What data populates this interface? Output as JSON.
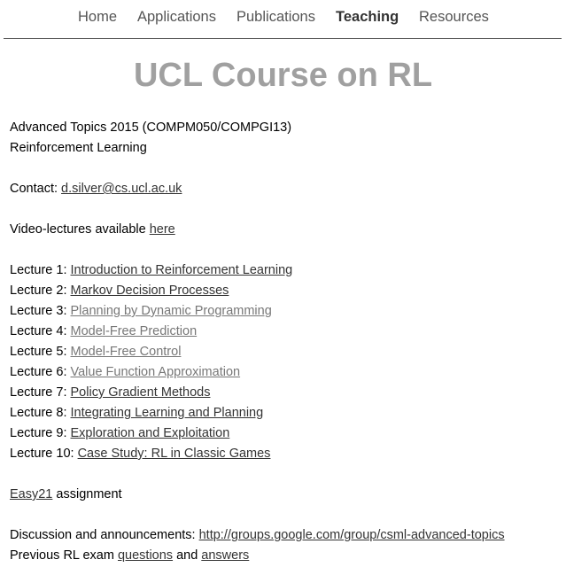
{
  "nav": {
    "items": [
      "Home",
      "Applications",
      "Publications",
      "Teaching",
      "Resources"
    ],
    "active": "Teaching"
  },
  "title": "UCL Course on RL",
  "course": {
    "line1": "Advanced Topics  2015 (COMPM050/COMPGI13)",
    "line2": "Reinforcement Learning"
  },
  "contact": {
    "label": "Contact: ",
    "email": "d.silver@cs.ucl.ac.uk"
  },
  "video": {
    "text": "Video-lectures available ",
    "link": "here"
  },
  "lectures": [
    {
      "label": "Lecture 1: ",
      "title": "Introduction to Reinforcement Learning"
    },
    {
      "label": "Lecture 2: ",
      "title": "Markov Decision Processes"
    },
    {
      "label": "Lecture 3: ",
      "title": "Planning by Dynamic Programming"
    },
    {
      "label": "Lecture 4: ",
      "title": "Model-Free Prediction"
    },
    {
      "label": "Lecture 5: ",
      "title": "Model-Free Control"
    },
    {
      "label": "Lecture 6: ",
      "title": "Value Function Approximation"
    },
    {
      "label": "Lecture 7: ",
      "title": "Policy Gradient Methods"
    },
    {
      "label": "Lecture 8: ",
      "title": "Integrating Learning and Planning"
    },
    {
      "label": "Lecture 9: ",
      "title": "Exploration and Exploitation"
    },
    {
      "label": "Lecture 10: ",
      "title": "Case Study: RL in Classic Games"
    }
  ],
  "assignment": {
    "link": "Easy21",
    "text": " assignment"
  },
  "discussion": {
    "label": "Discussion and announcements: ",
    "link": "http://groups.google.com/group/csml-advanced-topics"
  },
  "exam": {
    "label": "Previous RL exam ",
    "questions": "questions",
    "and": " and ",
    "answers": "answers"
  },
  "colors": {
    "title": "#a0a0a0",
    "nav_text": "#555555",
    "link": "#333333",
    "visited_link": "#777777"
  }
}
